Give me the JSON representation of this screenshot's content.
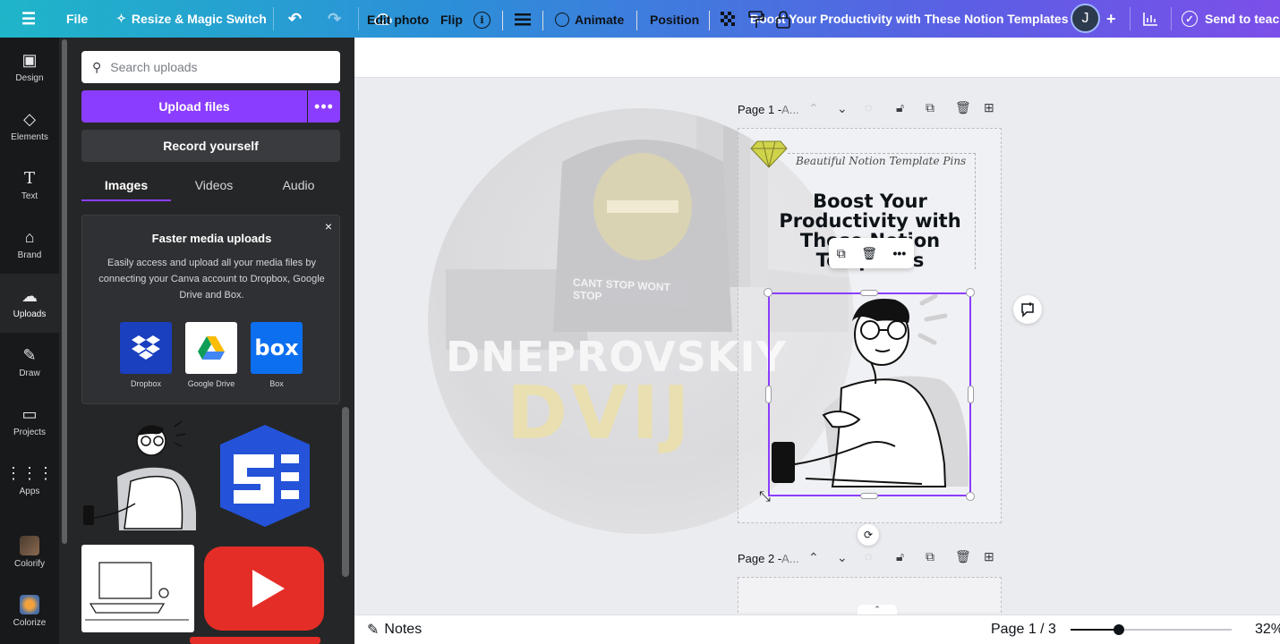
{
  "topbar": {
    "menu_icon": "hamburger-icon",
    "file_label": "File",
    "resize_label": "Resize & Magic Switch",
    "design_title": "Boost Your Productivity with These Notion Templates",
    "avatar_initial": "J",
    "add_icon": "+",
    "send_label": "Send to teacher"
  },
  "rail": {
    "items": [
      {
        "label": "Design",
        "icon": "design-icon"
      },
      {
        "label": "Elements",
        "icon": "elements-icon"
      },
      {
        "label": "Text",
        "icon": "text-icon"
      },
      {
        "label": "Brand",
        "icon": "brand-icon"
      },
      {
        "label": "Uploads",
        "icon": "uploads-icon",
        "active": true
      },
      {
        "label": "Draw",
        "icon": "draw-icon"
      },
      {
        "label": "Projects",
        "icon": "projects-icon"
      },
      {
        "label": "Apps",
        "icon": "apps-icon"
      },
      {
        "label": "Colorify",
        "icon": "colorify-app-icon"
      },
      {
        "label": "Colorize",
        "icon": "colorize-app-icon"
      }
    ]
  },
  "panel": {
    "search_placeholder": "Search uploads",
    "upload_label": "Upload files",
    "more_label": "•••",
    "record_label": "Record yourself",
    "tabs": [
      {
        "label": "Images",
        "active": true
      },
      {
        "label": "Videos",
        "active": false
      },
      {
        "label": "Audio",
        "active": false
      }
    ],
    "promo": {
      "close": "×",
      "title": "Faster media uploads",
      "text": "Easily access and upload all your media files by connecting your Canva account to Dropbox, Google Drive and Box.",
      "services": [
        {
          "label": "Dropbox",
          "color": "#1a3fbf"
        },
        {
          "label": "Google Drive",
          "color": "#ffffff"
        },
        {
          "label": "Box",
          "color": "#0b6ff0"
        }
      ]
    }
  },
  "toolbar": {
    "edit_photo": "Edit photo",
    "flip": "Flip",
    "animate": "Animate",
    "position": "Position"
  },
  "canvas": {
    "page1_label": "Page 1 - ",
    "page1_suffix": "A...",
    "page2_label": "Page 2 - ",
    "page2_suffix": "A...",
    "page_subtitle": "Beautiful Notion Template Pins",
    "page_title": "Boost Your Productivity with These Notion Templates",
    "ghost_word1": "DNEPROVSKIY",
    "ghost_word2": "DVIJ",
    "ghost_plate": "CANT STOP WONT STOP"
  },
  "footer": {
    "notes_label": "Notes",
    "page_indicator": "Page 1 / 3",
    "zoom": "32%",
    "zoom_fraction": 0.3
  },
  "colors": {
    "accent": "#8b3dff",
    "rail_bg": "#18191b",
    "panel_bg": "#252627"
  }
}
